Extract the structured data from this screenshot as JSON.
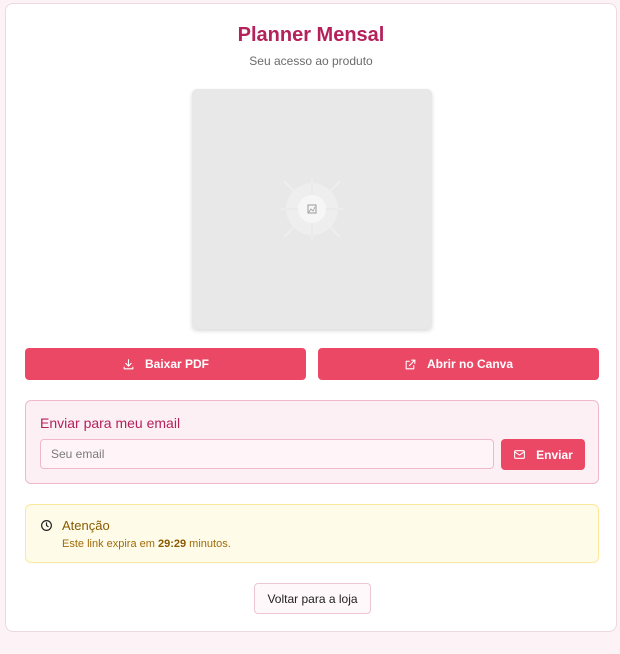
{
  "header": {
    "title": "Planner Mensal",
    "subtitle": "Seu acesso ao produto"
  },
  "actions": {
    "pdf_label": "Baixar PDF",
    "canva_label": "Abrir no Canva"
  },
  "email": {
    "title": "Enviar para meu email",
    "placeholder": "Seu email",
    "value": "",
    "send_label": "Enviar"
  },
  "alert": {
    "title": "Atenção",
    "text_prefix": "Este link expira em ",
    "time": "29:29",
    "text_suffix": " minutos."
  },
  "footer": {
    "back_label": "Voltar para a loja"
  },
  "icons": {
    "preview": "image-placeholder-icon",
    "pdf": "download-icon",
    "canva": "external-link-icon",
    "send": "mail-icon",
    "alert": "clock-icon"
  },
  "colors": {
    "accent": "#eb4866",
    "title": "#b5215a",
    "page_background": "#fdf2f6",
    "alert_background": "#fefce8",
    "alert_text": "#8a5a00"
  }
}
